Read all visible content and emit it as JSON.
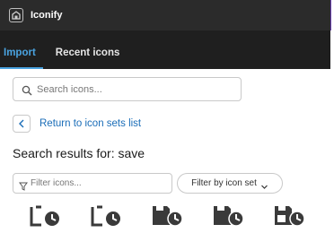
{
  "window": {
    "title": "Iconify",
    "app_icon": "iconify-logo-icon"
  },
  "tabs": [
    {
      "label": "Import",
      "active": true
    },
    {
      "label": "Recent icons",
      "active": false
    }
  ],
  "search": {
    "placeholder": "Search icons...",
    "icon": "search-icon"
  },
  "back_link": {
    "label": "Return to icon sets list",
    "icon": "chevron-left-icon"
  },
  "results_title": "Search results for: save",
  "filter": {
    "placeholder": "Filter icons...",
    "icon": "filter-icon"
  },
  "filter_by_set": {
    "label": "Filter by icon set",
    "icon": "chevron-down-icon"
  },
  "results": [
    {
      "icon": "save-history-icon",
      "style": "outline"
    },
    {
      "icon": "save-history-icon",
      "style": "outline"
    },
    {
      "icon": "save-history-icon",
      "style": "filled"
    },
    {
      "icon": "save-history-icon",
      "style": "filled"
    },
    {
      "icon": "save-history-icon",
      "style": "outline-filled"
    }
  ],
  "colors": {
    "titlebar_bg": "#2b2b2b",
    "tabs_bg": "#1f1f1f",
    "accent": "#4aa3e0",
    "link": "#1a6db8"
  }
}
